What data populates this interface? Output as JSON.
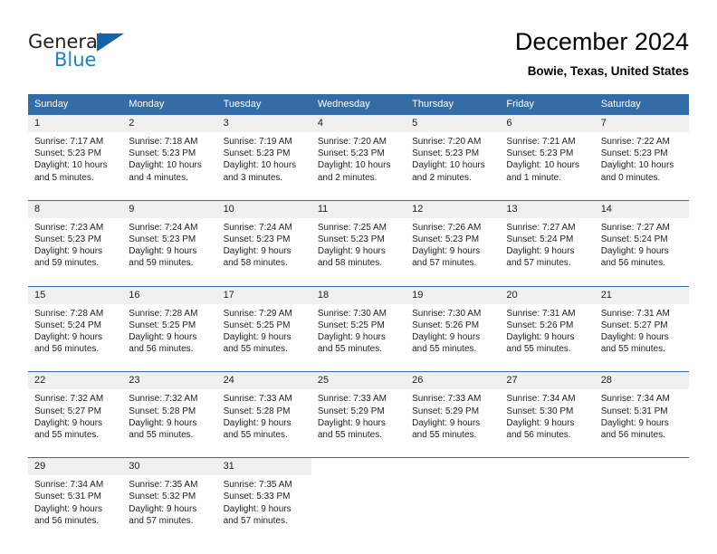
{
  "brand": {
    "name_part1": "General",
    "name_part2": "Blue",
    "color_dark": "#231f20",
    "color_blue": "#1f7fc4",
    "triangle_color": "#1263a8"
  },
  "header": {
    "title": "December 2024",
    "subtitle": "Bowie, Texas, United States"
  },
  "theme": {
    "header_bg": "#336ca6",
    "daynum_bg": "#f0f0f0",
    "text": "#222222"
  },
  "weekdays": [
    "Sunday",
    "Monday",
    "Tuesday",
    "Wednesday",
    "Thursday",
    "Friday",
    "Saturday"
  ],
  "weeks": [
    {
      "days": [
        {
          "num": "1",
          "sunrise": "Sunrise: 7:17 AM",
          "sunset": "Sunset: 5:23 PM",
          "daylight1": "Daylight: 10 hours",
          "daylight2": "and 5 minutes."
        },
        {
          "num": "2",
          "sunrise": "Sunrise: 7:18 AM",
          "sunset": "Sunset: 5:23 PM",
          "daylight1": "Daylight: 10 hours",
          "daylight2": "and 4 minutes."
        },
        {
          "num": "3",
          "sunrise": "Sunrise: 7:19 AM",
          "sunset": "Sunset: 5:23 PM",
          "daylight1": "Daylight: 10 hours",
          "daylight2": "and 3 minutes."
        },
        {
          "num": "4",
          "sunrise": "Sunrise: 7:20 AM",
          "sunset": "Sunset: 5:23 PM",
          "daylight1": "Daylight: 10 hours",
          "daylight2": "and 2 minutes."
        },
        {
          "num": "5",
          "sunrise": "Sunrise: 7:20 AM",
          "sunset": "Sunset: 5:23 PM",
          "daylight1": "Daylight: 10 hours",
          "daylight2": "and 2 minutes."
        },
        {
          "num": "6",
          "sunrise": "Sunrise: 7:21 AM",
          "sunset": "Sunset: 5:23 PM",
          "daylight1": "Daylight: 10 hours",
          "daylight2": "and 1 minute."
        },
        {
          "num": "7",
          "sunrise": "Sunrise: 7:22 AM",
          "sunset": "Sunset: 5:23 PM",
          "daylight1": "Daylight: 10 hours",
          "daylight2": "and 0 minutes."
        }
      ]
    },
    {
      "days": [
        {
          "num": "8",
          "sunrise": "Sunrise: 7:23 AM",
          "sunset": "Sunset: 5:23 PM",
          "daylight1": "Daylight: 9 hours",
          "daylight2": "and 59 minutes."
        },
        {
          "num": "9",
          "sunrise": "Sunrise: 7:24 AM",
          "sunset": "Sunset: 5:23 PM",
          "daylight1": "Daylight: 9 hours",
          "daylight2": "and 59 minutes."
        },
        {
          "num": "10",
          "sunrise": "Sunrise: 7:24 AM",
          "sunset": "Sunset: 5:23 PM",
          "daylight1": "Daylight: 9 hours",
          "daylight2": "and 58 minutes."
        },
        {
          "num": "11",
          "sunrise": "Sunrise: 7:25 AM",
          "sunset": "Sunset: 5:23 PM",
          "daylight1": "Daylight: 9 hours",
          "daylight2": "and 58 minutes."
        },
        {
          "num": "12",
          "sunrise": "Sunrise: 7:26 AM",
          "sunset": "Sunset: 5:23 PM",
          "daylight1": "Daylight: 9 hours",
          "daylight2": "and 57 minutes."
        },
        {
          "num": "13",
          "sunrise": "Sunrise: 7:27 AM",
          "sunset": "Sunset: 5:24 PM",
          "daylight1": "Daylight: 9 hours",
          "daylight2": "and 57 minutes."
        },
        {
          "num": "14",
          "sunrise": "Sunrise: 7:27 AM",
          "sunset": "Sunset: 5:24 PM",
          "daylight1": "Daylight: 9 hours",
          "daylight2": "and 56 minutes."
        }
      ]
    },
    {
      "days": [
        {
          "num": "15",
          "sunrise": "Sunrise: 7:28 AM",
          "sunset": "Sunset: 5:24 PM",
          "daylight1": "Daylight: 9 hours",
          "daylight2": "and 56 minutes."
        },
        {
          "num": "16",
          "sunrise": "Sunrise: 7:28 AM",
          "sunset": "Sunset: 5:25 PM",
          "daylight1": "Daylight: 9 hours",
          "daylight2": "and 56 minutes."
        },
        {
          "num": "17",
          "sunrise": "Sunrise: 7:29 AM",
          "sunset": "Sunset: 5:25 PM",
          "daylight1": "Daylight: 9 hours",
          "daylight2": "and 55 minutes."
        },
        {
          "num": "18",
          "sunrise": "Sunrise: 7:30 AM",
          "sunset": "Sunset: 5:25 PM",
          "daylight1": "Daylight: 9 hours",
          "daylight2": "and 55 minutes."
        },
        {
          "num": "19",
          "sunrise": "Sunrise: 7:30 AM",
          "sunset": "Sunset: 5:26 PM",
          "daylight1": "Daylight: 9 hours",
          "daylight2": "and 55 minutes."
        },
        {
          "num": "20",
          "sunrise": "Sunrise: 7:31 AM",
          "sunset": "Sunset: 5:26 PM",
          "daylight1": "Daylight: 9 hours",
          "daylight2": "and 55 minutes."
        },
        {
          "num": "21",
          "sunrise": "Sunrise: 7:31 AM",
          "sunset": "Sunset: 5:27 PM",
          "daylight1": "Daylight: 9 hours",
          "daylight2": "and 55 minutes."
        }
      ]
    },
    {
      "days": [
        {
          "num": "22",
          "sunrise": "Sunrise: 7:32 AM",
          "sunset": "Sunset: 5:27 PM",
          "daylight1": "Daylight: 9 hours",
          "daylight2": "and 55 minutes."
        },
        {
          "num": "23",
          "sunrise": "Sunrise: 7:32 AM",
          "sunset": "Sunset: 5:28 PM",
          "daylight1": "Daylight: 9 hours",
          "daylight2": "and 55 minutes."
        },
        {
          "num": "24",
          "sunrise": "Sunrise: 7:33 AM",
          "sunset": "Sunset: 5:28 PM",
          "daylight1": "Daylight: 9 hours",
          "daylight2": "and 55 minutes."
        },
        {
          "num": "25",
          "sunrise": "Sunrise: 7:33 AM",
          "sunset": "Sunset: 5:29 PM",
          "daylight1": "Daylight: 9 hours",
          "daylight2": "and 55 minutes."
        },
        {
          "num": "26",
          "sunrise": "Sunrise: 7:33 AM",
          "sunset": "Sunset: 5:29 PM",
          "daylight1": "Daylight: 9 hours",
          "daylight2": "and 55 minutes."
        },
        {
          "num": "27",
          "sunrise": "Sunrise: 7:34 AM",
          "sunset": "Sunset: 5:30 PM",
          "daylight1": "Daylight: 9 hours",
          "daylight2": "and 56 minutes."
        },
        {
          "num": "28",
          "sunrise": "Sunrise: 7:34 AM",
          "sunset": "Sunset: 5:31 PM",
          "daylight1": "Daylight: 9 hours",
          "daylight2": "and 56 minutes."
        }
      ]
    },
    {
      "days": [
        {
          "num": "29",
          "sunrise": "Sunrise: 7:34 AM",
          "sunset": "Sunset: 5:31 PM",
          "daylight1": "Daylight: 9 hours",
          "daylight2": "and 56 minutes."
        },
        {
          "num": "30",
          "sunrise": "Sunrise: 7:35 AM",
          "sunset": "Sunset: 5:32 PM",
          "daylight1": "Daylight: 9 hours",
          "daylight2": "and 57 minutes."
        },
        {
          "num": "31",
          "sunrise": "Sunrise: 7:35 AM",
          "sunset": "Sunset: 5:33 PM",
          "daylight1": "Daylight: 9 hours",
          "daylight2": "and 57 minutes."
        },
        {
          "num": "",
          "sunrise": "",
          "sunset": "",
          "daylight1": "",
          "daylight2": ""
        },
        {
          "num": "",
          "sunrise": "",
          "sunset": "",
          "daylight1": "",
          "daylight2": ""
        },
        {
          "num": "",
          "sunrise": "",
          "sunset": "",
          "daylight1": "",
          "daylight2": ""
        },
        {
          "num": "",
          "sunrise": "",
          "sunset": "",
          "daylight1": "",
          "daylight2": ""
        }
      ]
    }
  ]
}
